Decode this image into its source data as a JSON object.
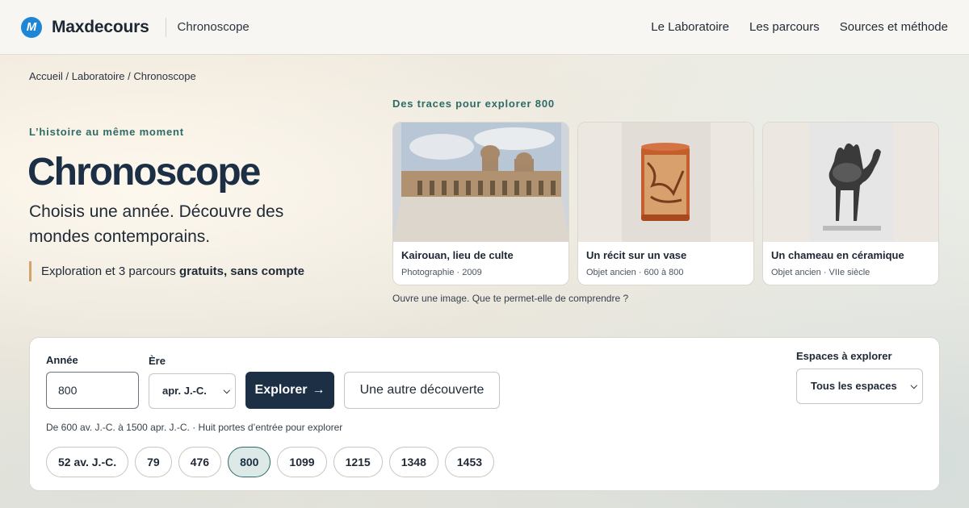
{
  "header": {
    "brand": "Maxdecours",
    "logo_letter": "M",
    "subbrand": "Chronoscope",
    "nav": [
      "Le Laboratoire",
      "Les parcours",
      "Sources et méthode"
    ]
  },
  "breadcrumb": "Accueil / Laboratoire / Chronoscope",
  "hero": {
    "eyebrow": "L’histoire au même moment",
    "title": "Chronoscope",
    "lead": "Choisis une année. Découvre des mondes contemporains.",
    "note_prefix": "Exploration et 3 parcours ",
    "note_bold": "gratuits, sans compte"
  },
  "traces": {
    "title": "Des traces pour explorer 800",
    "cards": [
      {
        "title": "Kairouan, lieu de culte",
        "meta": "Photographie · 2009"
      },
      {
        "title": "Un récit sur un vase",
        "meta": "Objet ancien · 600 à 800"
      },
      {
        "title": "Un chameau en céramique",
        "meta": "Objet ancien · VIIe siècle"
      }
    ],
    "hint": "Ouvre une image. Que te permet-elle de comprendre ?"
  },
  "search": {
    "year_label": "Année",
    "year_value": "800",
    "era_label": "Ère",
    "era_value": "apr. J.-C.",
    "explore_label": "Explorer",
    "explore_arrow": "→",
    "other_label": "Une autre découverte",
    "range_text": "De 600 av. J.-C. à 1500 apr. J.-C. · Huit portes d’entrée pour explorer",
    "chips": [
      "52 av. J.-C.",
      "79",
      "476",
      "800",
      "1099",
      "1215",
      "1348",
      "1453"
    ],
    "active_chip": "800",
    "spaces_label": "Espaces à explorer",
    "spaces_value": "Tous les espaces"
  },
  "colors": {
    "primary": "#1c2f45",
    "accent_teal": "#2e6b67",
    "accent_gold": "#d4a36a",
    "logo_blue": "#1f86d6"
  }
}
